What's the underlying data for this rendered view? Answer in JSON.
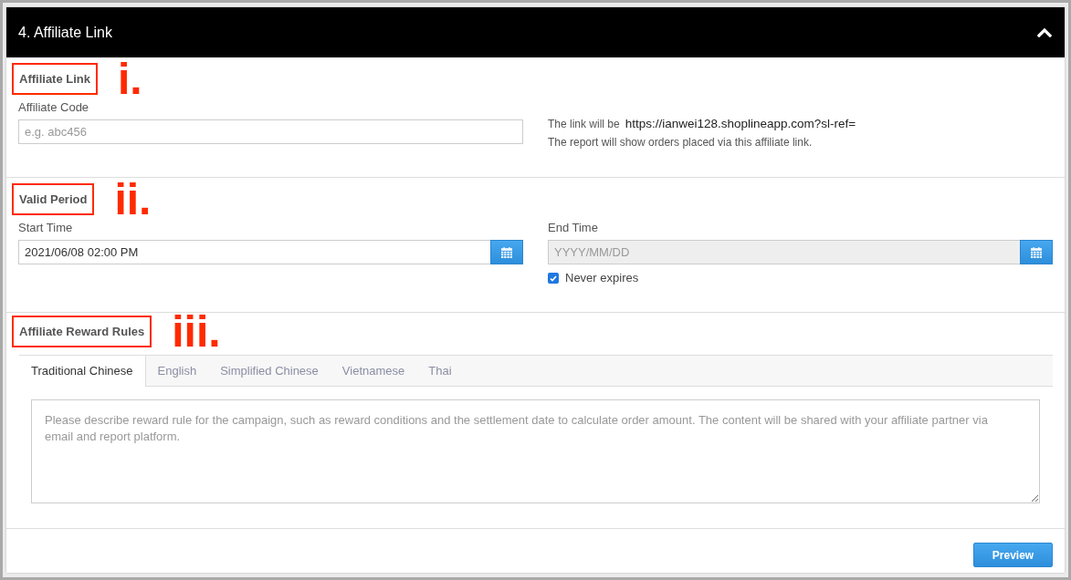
{
  "panel": {
    "title": "4. Affiliate Link",
    "expanded": true
  },
  "sections": [
    {
      "kind": "link",
      "heading": "Affiliate Link",
      "highlighted": true,
      "annotation": "i.",
      "field": {
        "label": "Affiliate Code",
        "placeholder": "e.g. abc456"
      },
      "link_prefix": "The link will be",
      "link_url": "https://ianwei128.shoplineapp.com?sl-ref=",
      "note": "The report will show orders placed via this affiliate link."
    },
    {
      "kind": "period",
      "heading": "Valid Period",
      "highlighted": true,
      "annotation": "ii.",
      "start": {
        "label": "Start Time",
        "value": "2021/06/08 02:00 PM",
        "disabled": false
      },
      "end": {
        "label": "End Time",
        "placeholder": "YYYY/MM/DD",
        "disabled": true
      },
      "never_expires": {
        "label": "Never expires",
        "checked": true
      }
    },
    {
      "kind": "rules",
      "heading": "Affiliate Reward Rules",
      "highlighted": true,
      "annotation": "iii.",
      "tabs": [
        {
          "label": "Traditional Chinese",
          "selected": true
        },
        {
          "label": "English",
          "selected": false
        },
        {
          "label": "Simplified Chinese",
          "selected": false
        },
        {
          "label": "Vietnamese",
          "selected": false
        },
        {
          "label": "Thai",
          "selected": false
        }
      ],
      "editor": {
        "placeholder": "Please describe reward rule for the campaign, such as reward conditions and the settlement date to calculate order amount. The content will be shared with your affiliate partner via email and report platform."
      }
    }
  ],
  "footer": {
    "button": "Preview"
  }
}
